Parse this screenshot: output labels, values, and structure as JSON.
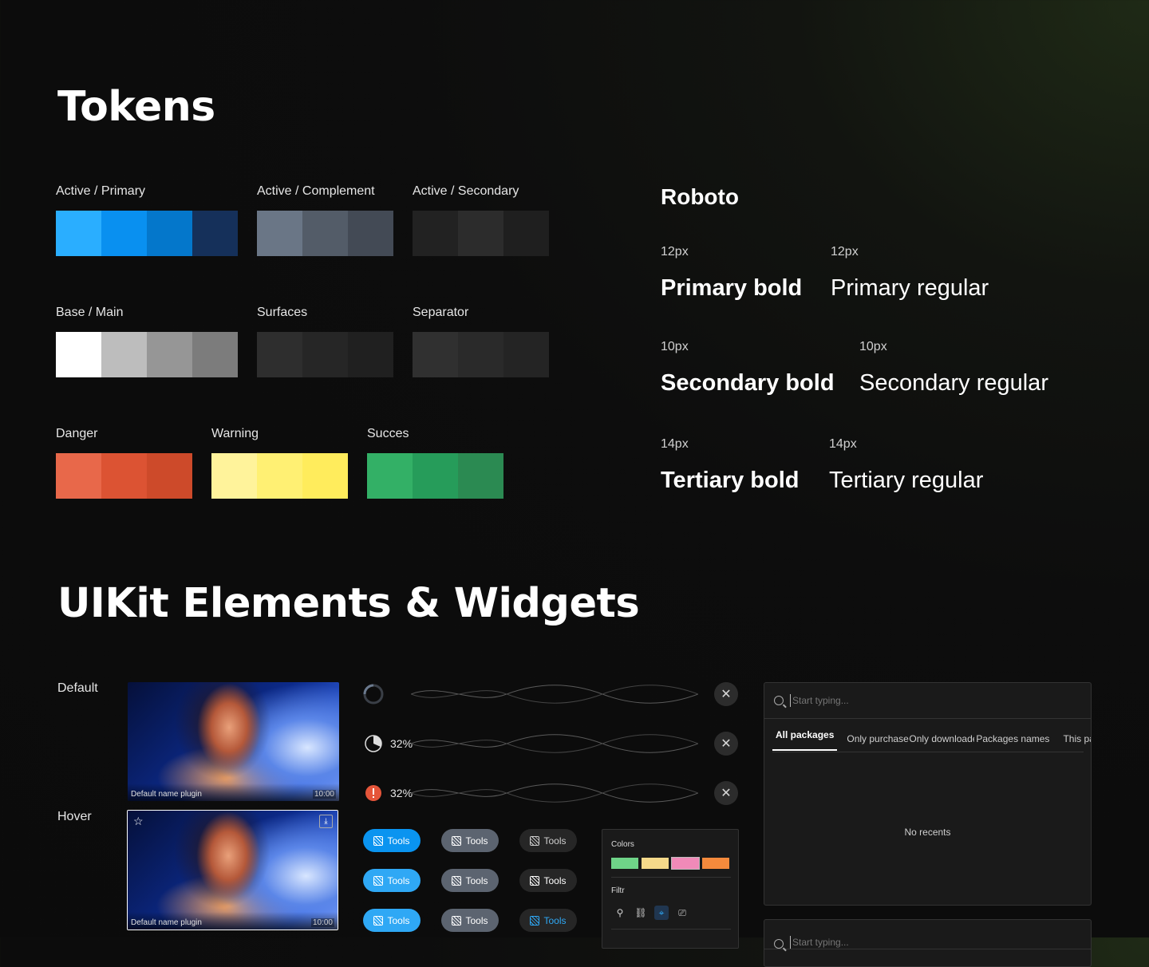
{
  "tokens": {
    "title": "Tokens",
    "groups": [
      {
        "label": "Active / Primary",
        "colors": [
          "#2aaeff",
          "#0990f0",
          "#0477cb",
          "#15305a"
        ]
      },
      {
        "label": "Active / Complement",
        "colors": [
          "#6a7686",
          "#535c68",
          "#434a55"
        ]
      },
      {
        "label": "Active / Secondary",
        "colors": [
          "#222222",
          "#2c2c2c",
          "#1f1f1f"
        ]
      },
      {
        "label": "Base / Main",
        "colors": [
          "#ffffff",
          "#bdbdbd",
          "#969696",
          "#7c7c7c"
        ]
      },
      {
        "label": "Surfaces",
        "colors": [
          "#2e2e2e",
          "#262626",
          "#202020"
        ]
      },
      {
        "label": "Separator",
        "colors": [
          "#303030",
          "#2a2a2a",
          "#242424"
        ]
      },
      {
        "label": "Danger",
        "colors": [
          "#e8684a",
          "#dc5333",
          "#cd4a2a"
        ]
      },
      {
        "label": "Warning",
        "colors": [
          "#fff39b",
          "#fff073",
          "#ffec5c"
        ]
      },
      {
        "label": "Succes",
        "colors": [
          "#33b066",
          "#269c5a",
          "#2b8a52"
        ]
      }
    ]
  },
  "typography": {
    "font_name": "Roboto",
    "rows": [
      {
        "bold_size": "12px",
        "bold_label": "Primary bold",
        "reg_size": "12px",
        "reg_label": "Primary regular"
      },
      {
        "bold_size": "10px",
        "bold_label": "Secondary bold",
        "reg_size": "10px",
        "reg_label": "Secondary regular"
      },
      {
        "bold_size": "14px",
        "bold_label": "Tertiary bold",
        "reg_size": "14px",
        "reg_label": "Tertiary regular"
      }
    ]
  },
  "uikit": {
    "title": "UIKit Elements & Widgets",
    "card_states": {
      "default": "Default",
      "hover": "Hover"
    },
    "card": {
      "name": "Default name plugin",
      "time": "10:00"
    },
    "progress": [
      {
        "percent": ""
      },
      {
        "percent": "32%"
      },
      {
        "percent": "32%"
      }
    ],
    "close_symbol": "✕",
    "tool_label": "Tools",
    "filter_panel": {
      "colors_label": "Colors",
      "colors": [
        "#6fd488",
        "#f5d98a",
        "#f08ab8",
        "#f58a3c"
      ],
      "filter_label": "Filtr"
    },
    "search_panel": {
      "placeholder": "Start typing...",
      "tabs": [
        "All packages",
        "Only purchased",
        "Only downloaded",
        "Packages names",
        "This pac"
      ],
      "empty_text": "No recents"
    },
    "search_panel_2": {
      "placeholder": "Start typing..."
    }
  }
}
